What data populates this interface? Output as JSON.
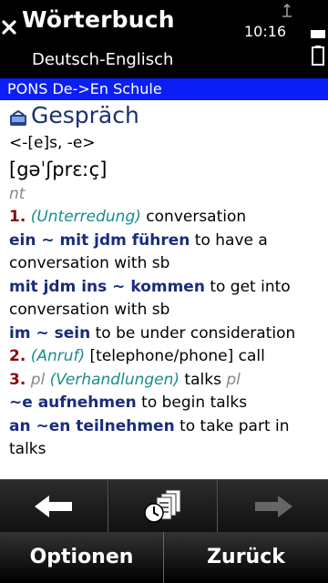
{
  "titlebar": {
    "title": "Wörterbuch",
    "subtitle": "Deutsch-Englisch",
    "clock": "10:16"
  },
  "dictionary": {
    "name": "PONS De->En Schule"
  },
  "entry": {
    "headword": "Gespräch",
    "grammar": "<-[e]s, -e>",
    "phonetic": "[gəˈʃprɛːç]",
    "gender": "nt",
    "senses": [
      {
        "number": "1.",
        "gloss": "(Unterredung)",
        "translation": " conversation"
      },
      {
        "number": "2.",
        "gloss": "(Anruf)",
        "translation": " [telephone/phone] call"
      },
      {
        "number": "3.",
        "label": "pl",
        "gloss": "(Verhandlungen)",
        "translation": " talks ",
        "label2": "pl"
      }
    ],
    "phrases": [
      {
        "phrase": "ein ~ mit jdm führen",
        "translation": " to have a",
        "translation_cont": "conversation with sb"
      },
      {
        "phrase": "mit jdm ins ~ kommen",
        "translation": " to get into",
        "translation_cont": "conversation with sb"
      },
      {
        "phrase": "im ~ sein",
        "translation": " to be under consideration"
      },
      {
        "phrase": "~e aufnehmen",
        "translation": " to begin talks"
      },
      {
        "phrase": "an ~en teilnehmen",
        "translation": " to take part in",
        "translation_cont": "talks"
      }
    ]
  },
  "softkeys": {
    "left": "Optionen",
    "right": "Zurück"
  },
  "icons": {
    "close": "close-icon",
    "speaker": "speaker-icon",
    "back": "arrow-left-icon",
    "history": "history-icon",
    "forward": "arrow-right-icon"
  },
  "colors": {
    "band": "#0a1ef5",
    "headword": "#1a3070",
    "sense_number": "#8b0a0a",
    "gloss": "#1a8c8c",
    "phrase": "#1a2c7a"
  }
}
